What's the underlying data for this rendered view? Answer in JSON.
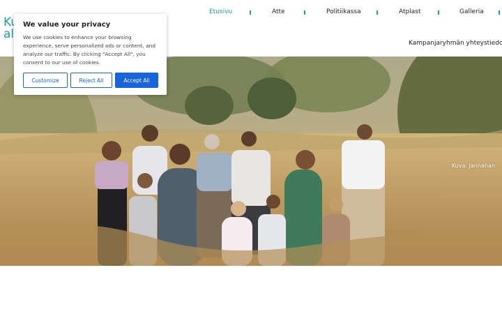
{
  "header": {
    "brand_line1": "Ku",
    "brand_line2": "al",
    "nav": [
      {
        "label": "Etusivu",
        "active": true
      },
      {
        "label": "Atte",
        "active": false
      },
      {
        "label": "Politiikassa",
        "active": false
      },
      {
        "label": "Atplast",
        "active": false
      },
      {
        "label": "Galleria",
        "active": false
      }
    ],
    "nav_row2": "Kampanjaryhmän yhteystiedot",
    "accent_color": "#1aa39a"
  },
  "hero": {
    "caption": "Kuva: Jannahan"
  },
  "cookie_banner": {
    "title": "We value your privacy",
    "text": "We use cookies to enhance your browsing experience, serve personalized ads or content, and analyze our traffic. By clicking \"Accept All\", you consent to our use of cookies.",
    "customize_label": "Customize",
    "reject_label": "Reject All",
    "accept_label": "Accept All",
    "button_color": "#1863dc"
  }
}
